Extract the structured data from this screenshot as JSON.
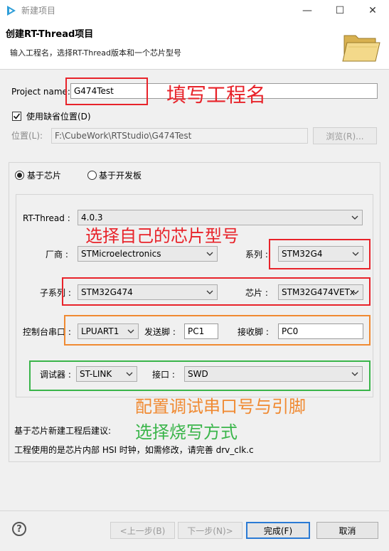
{
  "window": {
    "title": "新建项目",
    "minimize_glyph": "—",
    "maximize_glyph": "☐",
    "close_glyph": "✕",
    "icon": "rt-thread-studio-icon"
  },
  "header": {
    "title": "创建RT-Thread项目",
    "description": "输入工程名，选择RT-Thread版本和一个芯片型号",
    "icon": "open-folder-icon"
  },
  "form": {
    "project_name_label": "Project name:",
    "project_name_value": "G474Test",
    "use_default_location_label": "使用缺省位置(D)",
    "use_default_location_checked": true,
    "location_label": "位置(L):",
    "location_value": "F:\\CubeWork\\RTStudio\\G474Test",
    "browse_label": "浏览(R)..."
  },
  "mode": {
    "chip_label": "基于芯片",
    "board_label": "基于开发板",
    "selected": "chip"
  },
  "chip": {
    "rtthread_label": "RT-Thread :",
    "rtthread_value": "4.0.3",
    "vendor_label": "厂商 :",
    "vendor_value": "STMicroelectronics",
    "series_label": "系列 :",
    "series_value": "STM32G4",
    "subseries_label": "子系列 :",
    "subseries_value": "STM32G474",
    "chip_label": "芯片 :",
    "chip_value": "STM32G474VETx",
    "console_label": "控制台串口 :",
    "console_value": "LPUART1",
    "tx_label": "发送脚 :",
    "tx_value": "PC1",
    "rx_label": "接收脚 :",
    "rx_value": "PC0",
    "debugger_label": "调试器 :",
    "debugger_value": "ST-LINK",
    "interface_label": "接口 :",
    "interface_value": "SWD"
  },
  "advice": {
    "title": "基于芯片新建工程后建议:",
    "text": "工程使用的是芯片内部 HSI 时钟，如需修改，请完善 drv_clk.c"
  },
  "annotations": {
    "project_name": "填写工程名",
    "chip_select": "选择自己的芯片型号",
    "serial_config": "配置调试串口号与引脚",
    "debug_config": "选择烧写方式",
    "colors": {
      "red": "#e8232a",
      "orange": "#f08a32",
      "green": "#3ab54a"
    }
  },
  "buttons": {
    "help_glyph": "?",
    "back": "<上一步(B)",
    "next": "下一步(N)>",
    "finish": "完成(F)",
    "cancel": "取消"
  }
}
